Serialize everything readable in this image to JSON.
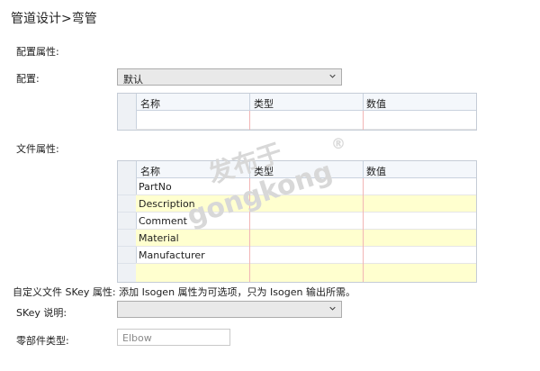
{
  "title": "管道设计>弯管",
  "config_section_label": "配置属性:",
  "config_label": "配置:",
  "config_select_value": "默认",
  "config_grid": {
    "columns": [
      "名称",
      "类型",
      "数值"
    ],
    "rows": [
      ""
    ]
  },
  "file_section_label": "文件属性:",
  "file_grid": {
    "columns": [
      "名称",
      "类型",
      "数值"
    ],
    "rows": [
      "PartNo",
      "Description",
      "Comment",
      "Material",
      "Manufacturer",
      ""
    ]
  },
  "note": "自定义文件 SKey 属性: 添加 Isogen 属性为可选项，只为 Isogen 输出所需。",
  "skey_label": "SKey 说明:",
  "skey_select_value": "",
  "part_type_label": "零部件类型:",
  "part_type_placeholder": "Elbow",
  "watermark": {
    "line1": "发布于",
    "line2": "gongkong",
    "mark": "®"
  }
}
